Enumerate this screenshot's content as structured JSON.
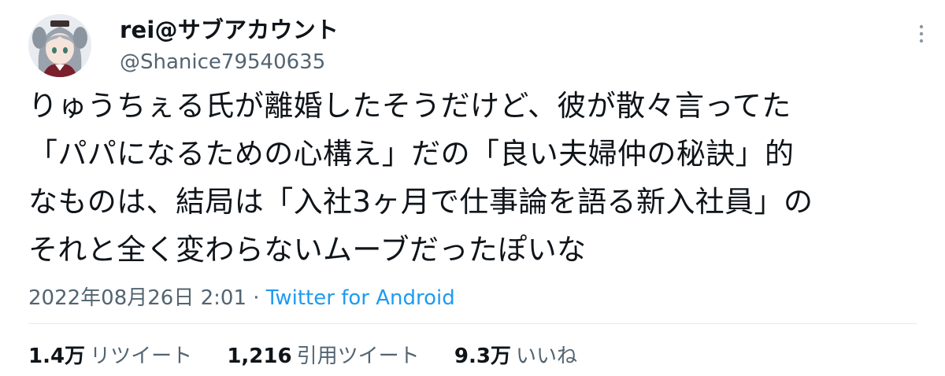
{
  "author": {
    "display_name": "rei@サブアカウント",
    "handle": "@Shanice79540635",
    "avatar_icon": "anime-avatar-icon"
  },
  "more_icon": "more-vertical-icon",
  "tweet": {
    "lines": [
      "りゅうちぇる氏が離婚したそうだけど、彼が散々言ってた",
      "「パパになるための心構え」だの「良い夫婦仲の秘訣」的",
      "なものは、結局は「入社3ヶ月で仕事論を語る新入社員」の",
      "それと全く変わらないムーブだったぽいな"
    ]
  },
  "meta": {
    "timestamp": "2022年08月26日 2:01",
    "separator": " · ",
    "source": "Twitter for Android"
  },
  "stats": {
    "retweets": {
      "count": "1.4万",
      "label": "リツイート"
    },
    "quotes": {
      "count": "1,216",
      "label": "引用ツイート"
    },
    "likes": {
      "count": "9.3万",
      "label": "いいね"
    }
  },
  "colors": {
    "text": "#0f1419",
    "secondary": "#536471",
    "link": "#1d9bf0",
    "divider": "#e7e9ec"
  }
}
